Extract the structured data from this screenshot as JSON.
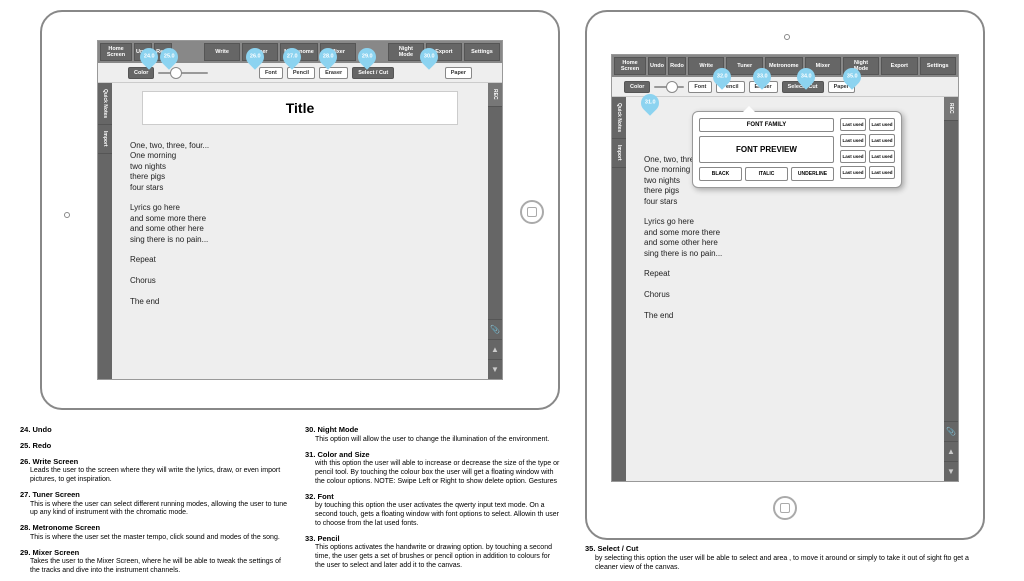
{
  "top": {
    "home": "Home Screen",
    "undo": "Undo",
    "redo": "Redo",
    "write": "Write",
    "tuner": "Tuner",
    "metronome": "Metronome",
    "mixer": "Mixer",
    "night": "Night Mode",
    "export": "Export",
    "settings": "Settings"
  },
  "tool": {
    "color": "Color",
    "font": "Font",
    "pencil": "Pencil",
    "eraser": "Eraser",
    "select": "Select / Cut",
    "paper": "Paper"
  },
  "side": {
    "quick": "Quick Notes",
    "import": "Import",
    "rec": "REC"
  },
  "title": "Title",
  "lyrics": "One, two, three, four...\nOne morning\ntwo nights\nthere pigs\nfour stars\n\nLyrics go here\nand some more there\nand some other here\nsing there is no pain...\n\nRepeat\n\nChorus\n\nThe end",
  "bubbles": {
    "b24": "24.0",
    "b25": "25.0",
    "b26": "26.0",
    "b27": "27.0",
    "b28": "28.0",
    "b29": "29.0",
    "b30": "30.0",
    "b31": "31.0",
    "b32": "32.0",
    "b33": "33.0",
    "b34": "34.0",
    "b35": "35.0"
  },
  "popup": {
    "family": "FONT FAMILY",
    "preview": "FONT PREVIEW",
    "black": "BLACK",
    "italic": "ITALIC",
    "underline": "UNDERLINE",
    "last": "Last used"
  },
  "desc": {
    "d24": {
      "t": "24. Undo"
    },
    "d25": {
      "t": "25. Redo"
    },
    "d26": {
      "t": "26. Write Screen",
      "s": "Leads the user to the screen where they will write the lyrics, draw, or even import pictures, to get inspiration."
    },
    "d27": {
      "t": "27. Tuner Screen",
      "s": "This is where the user can select different running modes, allowing the user to tune up any kind of instrument with the chromatic mode."
    },
    "d28": {
      "t": "28. Metronome Screen",
      "s": "This is where the user set the master tempo, click sound and modes of the song."
    },
    "d29": {
      "t": "29. Mixer Screen",
      "s": "Takes the user to the Mixer Screen, where he will be able to tweak the settings of the tracks and dive into the instrument channels."
    },
    "d30": {
      "t": "30. Night Mode",
      "s": "This option will allow the user to change the illumination of the environment."
    },
    "d31": {
      "t": "31. Color and Size",
      "s": "with this option the user will able to increase or decrease the size of the type or pencil tool. By touching the colour box the user will get a floating window with the colour options.\nNOTE: Swipe Left or Right to show delete option. Gestures"
    },
    "d32": {
      "t": "32. Font",
      "s": "by touching this option the user activates the qwerty input text mode. On a second touch, gets a floating window with font options to select. Allowin th user to choose from the lat used fonts."
    },
    "d33": {
      "t": "33. Pencil",
      "s": "This options activates the handwrite or drawing option. by touching a second time, the user gets a set of brushes or pencil option in addition to colours for the user to select and later add it to the canvas."
    },
    "d35": {
      "t": "35. Select / Cut",
      "s": "by selecting this option the user will be able to select and area , to move it around or simply to take it out of sight fto get a cleaner view of the canvas."
    }
  }
}
